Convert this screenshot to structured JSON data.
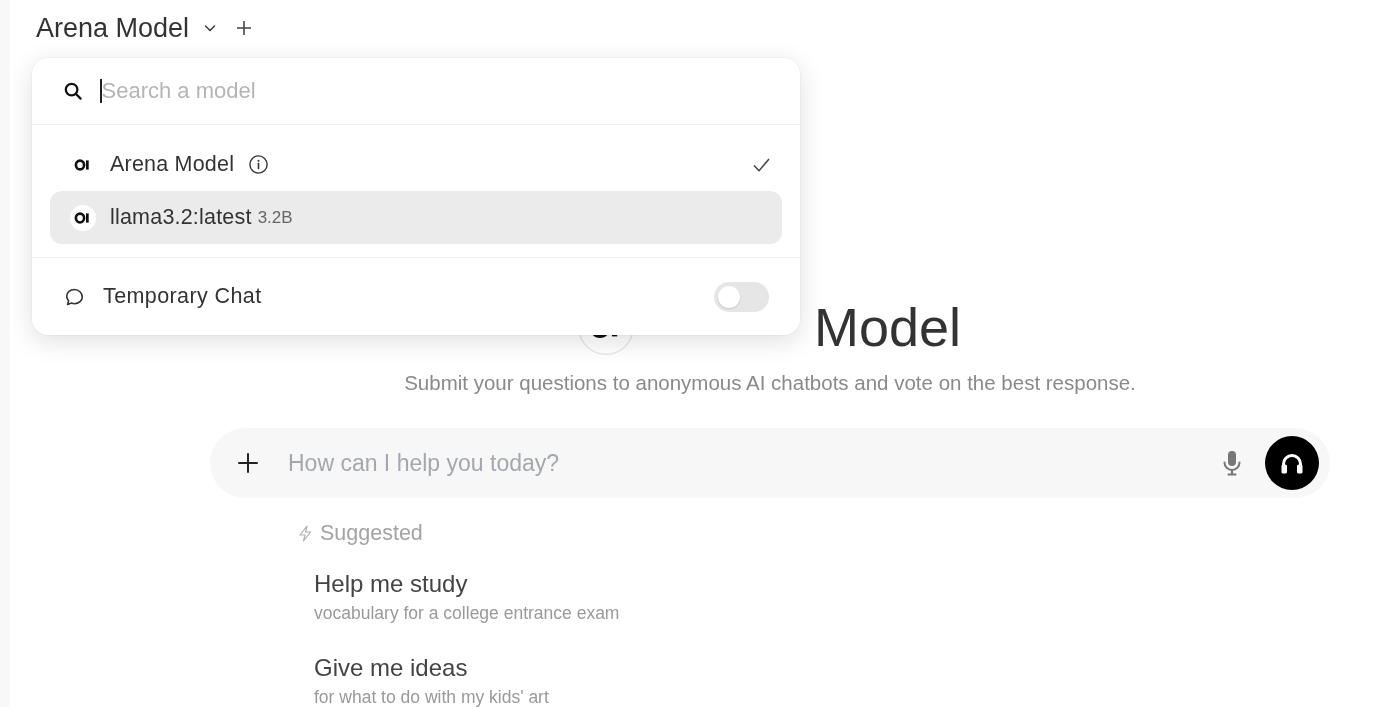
{
  "header": {
    "title": "Arena Model"
  },
  "model_menu": {
    "search": {
      "placeholder": "Search a model",
      "focused": true
    },
    "models": [
      {
        "name": "Arena Model",
        "info": true,
        "selected": true,
        "highlighted": false
      },
      {
        "name": "llama3.2:latest",
        "size": "3.2B",
        "info": false,
        "selected": false,
        "highlighted": true
      }
    ],
    "temporary_chat": {
      "label": "Temporary Chat",
      "on": false
    }
  },
  "hero": {
    "title": "Model",
    "subtitle": "Submit your questions to anonymous AI chatbots and vote on the best response."
  },
  "composer": {
    "placeholder": "How can I help you today?"
  },
  "suggestions": {
    "heading": "Suggested",
    "items": [
      {
        "title": "Help me study",
        "description": "vocabulary for a college entrance exam"
      },
      {
        "title": "Give me ideas",
        "description": "for what to do with my kids' art"
      }
    ]
  }
}
